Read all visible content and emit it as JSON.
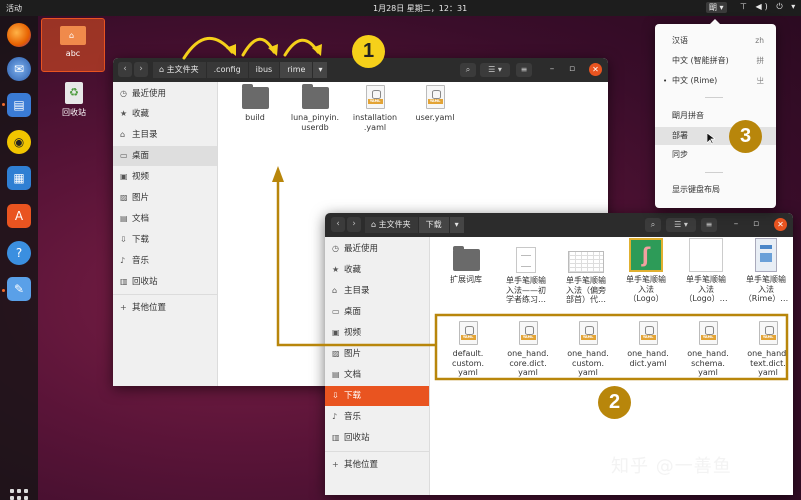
{
  "topbar": {
    "activities": "活动",
    "clock": "1月28日 星期二，12：31",
    "ime_indicator": "朙 ▾",
    "tray": "⊤ ◀) ⏻ ▾"
  },
  "desktop": {
    "folder_label": "abc",
    "trash_label": "回收站"
  },
  "window1": {
    "breadcrumbs": [
      "主文件夹",
      ".config",
      "ibus",
      "rime"
    ],
    "sidebar": [
      "最近使用",
      "收藏",
      "主目录",
      "桌面",
      "视频",
      "图片",
      "文档",
      "下载",
      "音乐",
      "回收站",
      "其他位置"
    ],
    "files": [
      {
        "name": "build",
        "kind": "folder"
      },
      {
        "name": "luna_pinyin.\nuserdb",
        "kind": "folder"
      },
      {
        "name": "installation\n.yaml",
        "kind": "yaml"
      },
      {
        "name": "user.yaml",
        "kind": "yaml"
      }
    ]
  },
  "window2": {
    "breadcrumbs": [
      "主文件夹",
      "下载"
    ],
    "sidebar": [
      "最近使用",
      "收藏",
      "主目录",
      "桌面",
      "视频",
      "图片",
      "文档",
      "下载",
      "音乐",
      "回收站",
      "其他位置"
    ],
    "files_row1": [
      {
        "name": "扩展词库",
        "kind": "folder"
      },
      {
        "name": "单手笔顺输\n入法——初\n学者练习…",
        "kind": "doc"
      },
      {
        "name": "单手笔顺输\n入法（偏旁\n部首）代…",
        "kind": "table"
      },
      {
        "name": "单手笔顺输\n入法\n（Logo）",
        "kind": "logo"
      },
      {
        "name": "单手笔顺输\n入法\n（Logo）…",
        "kind": "blank"
      },
      {
        "name": "单手笔顺输\n入法\n（Rime）…",
        "kind": "shot"
      }
    ],
    "files_row2": [
      {
        "name": "default.\ncustom.\nyaml",
        "kind": "yaml"
      },
      {
        "name": "one_hand.\ncore.dict.\nyaml",
        "kind": "yaml"
      },
      {
        "name": "one_hand.\ncustom.\nyaml",
        "kind": "yaml"
      },
      {
        "name": "one_hand.\ndict.yaml",
        "kind": "yaml"
      },
      {
        "name": "one_hand.\nschema.\nyaml",
        "kind": "yaml"
      },
      {
        "name": "one_hand.\ntext.dict.\nyaml",
        "kind": "yaml"
      }
    ]
  },
  "menu": {
    "items": [
      {
        "label": "汉语",
        "key": "zh"
      },
      {
        "label": "中文 (智能拼音)",
        "key": "拼"
      },
      {
        "label": "中文 (Rime)",
        "key": "㞢"
      },
      {
        "label": "朙月拼音",
        "key": ""
      },
      {
        "label": "部署",
        "key": ""
      },
      {
        "label": "同步",
        "key": ""
      },
      {
        "label": "显示键盘布局",
        "key": ""
      }
    ]
  },
  "annotations": {
    "badge1": "1",
    "badge2": "2",
    "badge3": "3",
    "yaml_tag": "YAML",
    "watermark": "知乎 @一善鱼"
  },
  "colors": {
    "accent": "#e95420",
    "annotation_arrow": "#b8860b",
    "annotation_arrow_top": "#f5d01a"
  }
}
